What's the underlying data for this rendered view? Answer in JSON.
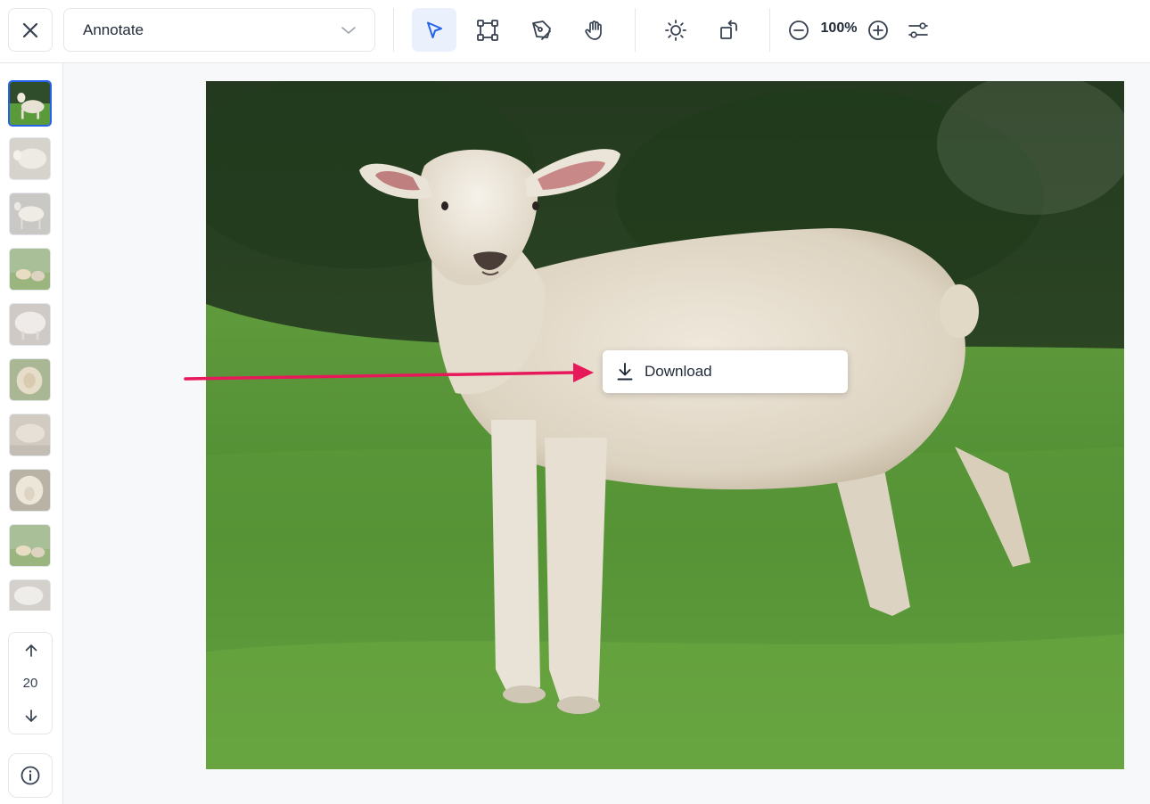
{
  "toolbar": {
    "close_icon": "close-icon",
    "mode_select": {
      "value": "Annotate",
      "icon": "chevron-down-icon"
    },
    "tools": [
      {
        "name": "select-tool",
        "icon": "pointer-icon",
        "active": true
      },
      {
        "name": "rectangle-tool",
        "icon": "bounding-box-icon",
        "active": false
      },
      {
        "name": "pen-tool",
        "icon": "pen-nib-icon",
        "active": false
      },
      {
        "name": "pan-tool",
        "icon": "hand-icon",
        "active": false
      },
      {
        "name": "brightness-tool",
        "icon": "sun-icon",
        "active": false
      },
      {
        "name": "rotate-tool",
        "icon": "rotate-icon",
        "active": false
      }
    ],
    "zoom": {
      "level": "100%",
      "zoom_out_icon": "minus-circle-icon",
      "zoom_in_icon": "plus-circle-icon"
    },
    "settings_icon": "sliders-icon"
  },
  "sidebar": {
    "thumbnails": [
      "lamb",
      "sheep-white",
      "sheep-side",
      "sheep-pair",
      "sheep-fluffy",
      "sheep-face",
      "sheep-blurry",
      "sheep-closeup",
      "sheep-pair-2",
      "sheep-partial"
    ],
    "selected_index": 0,
    "pager": {
      "page": "20",
      "up_icon": "arrow-up-icon",
      "down_icon": "arrow-down-icon"
    },
    "info_icon": "info-icon"
  },
  "canvas": {
    "context_menu": {
      "item_label": "Download",
      "icon": "download-icon"
    },
    "arrow_color": "#e8195a"
  },
  "colors": {
    "accent": "#2563eb",
    "active_bg": "#eaf1fd",
    "border": "#e3e6ea"
  }
}
